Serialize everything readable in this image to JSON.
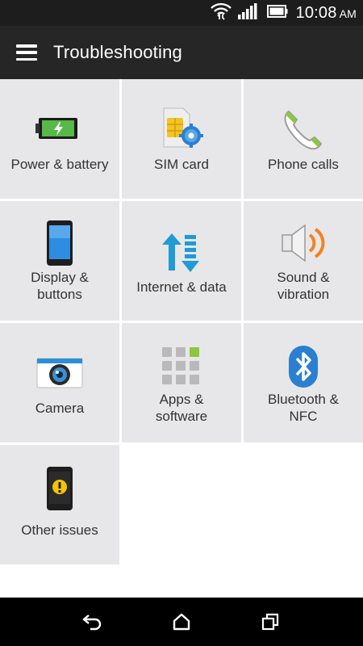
{
  "status_bar": {
    "time": "10:08",
    "ampm": "AM",
    "icons": [
      "wifi-icon",
      "signal-icon",
      "battery-icon"
    ]
  },
  "app_bar": {
    "title": "Troubleshooting",
    "menu_icon": "hamburger-menu-icon"
  },
  "tiles": [
    {
      "label": "Power & battery",
      "icon": "battery-charging-icon"
    },
    {
      "label": "SIM card",
      "icon": "sim-card-icon"
    },
    {
      "label": "Phone calls",
      "icon": "phone-icon"
    },
    {
      "label_line1": "Display &",
      "label_line2": "buttons",
      "icon": "display-phone-icon"
    },
    {
      "label": "Internet & data",
      "icon": "internet-data-icon"
    },
    {
      "label_line1": "Sound &",
      "label_line2": "vibration",
      "icon": "speaker-icon"
    },
    {
      "label": "Camera",
      "icon": "camera-icon"
    },
    {
      "label_line1": "Apps &",
      "label_line2": "software",
      "icon": "apps-grid-icon"
    },
    {
      "label_line1": "Bluetooth &",
      "label_line2": "NFC",
      "icon": "bluetooth-icon"
    },
    {
      "label": "Other issues",
      "icon": "warning-phone-icon"
    }
  ],
  "nav_bar": {
    "buttons": [
      "back-icon",
      "home-icon",
      "recent-apps-icon"
    ]
  },
  "colors": {
    "status_bar": "#1d1d1d",
    "app_bar": "#262626",
    "tile": "#e7e7e9",
    "accent_green": "#8dc63f",
    "accent_blue": "#2a8fd6",
    "accent_orange": "#f58220"
  }
}
